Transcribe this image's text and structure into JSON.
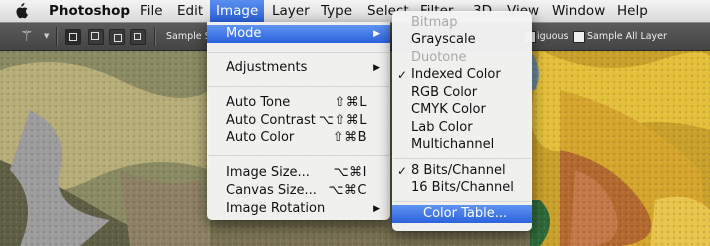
{
  "menubar": {
    "apple_icon": "apple-logo-icon",
    "items": [
      "Photoshop",
      "File",
      "Edit",
      "Image",
      "Layer",
      "Type",
      "Select",
      "Filter",
      "3D",
      "View",
      "Window",
      "Help"
    ],
    "active": "Image"
  },
  "toolbar": {
    "sample_size_label": "Sample Siz",
    "contiguous_label": "iguous",
    "sample_all_layers_label": "Sample All Layer"
  },
  "image_menu": {
    "items": [
      {
        "label": "Mode",
        "shortcut": "",
        "submenu": true,
        "highlighted": true
      },
      {
        "label": "Adjustments",
        "shortcut": "",
        "submenu": true
      },
      {
        "label": "Auto Tone",
        "shortcut": "⇧⌘L"
      },
      {
        "label": "Auto Contrast",
        "shortcut": "⌥⇧⌘L"
      },
      {
        "label": "Auto Color",
        "shortcut": "⇧⌘B"
      },
      {
        "label": "Image Size...",
        "shortcut": "⌥⌘I"
      },
      {
        "label": "Canvas Size...",
        "shortcut": "⌥⌘C"
      },
      {
        "label": "Image Rotation",
        "shortcut": "",
        "submenu": true
      }
    ]
  },
  "mode_menu": {
    "items": [
      {
        "label": "Bitmap",
        "disabled": true
      },
      {
        "label": "Grayscale"
      },
      {
        "label": "Duotone",
        "disabled": true
      },
      {
        "label": "Indexed Color",
        "checked": true
      },
      {
        "label": "RGB Color"
      },
      {
        "label": "CMYK Color"
      },
      {
        "label": "Lab Color"
      },
      {
        "label": "Multichannel"
      },
      {
        "label": "8 Bits/Channel",
        "checked": true
      },
      {
        "label": "16 Bits/Channel"
      },
      {
        "label": "Color Table...",
        "highlighted": true
      }
    ],
    "check_glyph": "✓"
  },
  "colors": {
    "highlight": "#2c62dc",
    "toolbar": "#4a4a4a",
    "menu_bg": "#f4f4f4"
  }
}
